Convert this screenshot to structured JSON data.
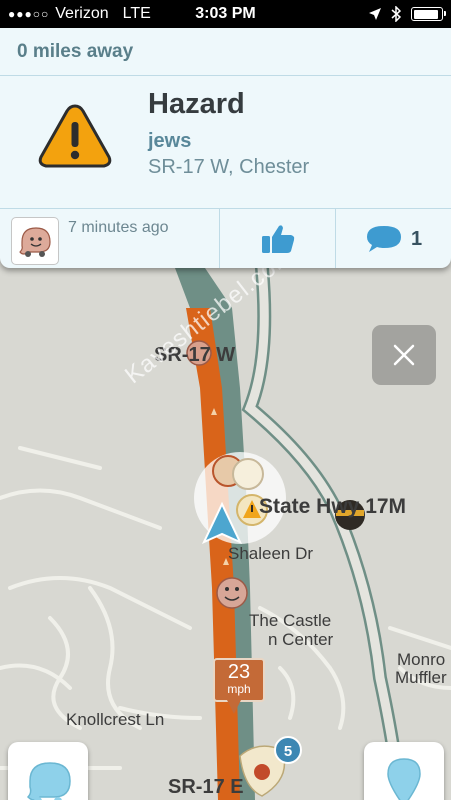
{
  "status_bar": {
    "signal": "●●●○○",
    "carrier": "Verizon",
    "network": "LTE",
    "time": "3:03 PM",
    "battery_level": 0.9
  },
  "alert_card": {
    "distance": "0 miles away",
    "title": "Hazard",
    "subtitle": "jews",
    "location": "SR-17 W, Chester",
    "reported_time": "7 minutes ago",
    "comment_count": "1",
    "icon": "warning-triangle-icon"
  },
  "map": {
    "labels": {
      "sr17w": "SR-17 W",
      "state_hwy": "State Hwy 17M",
      "shaleen": "Shaleen Dr",
      "castle_1": "The Castle",
      "castle_2": "n Center",
      "monroe_1": "Monro",
      "monroe_2": "Muffler",
      "knollcrest": "Knollcrest Ln",
      "sr17e": "SR-17 E"
    },
    "watermark": "Kaveshtiebel.com",
    "speed": "23",
    "speed_unit": "mph",
    "report_count": "5"
  },
  "colors": {
    "route": "#d9641a",
    "road_fill": "#e4e4de",
    "road_edge": "#6f8f86",
    "card_bg": "#eef8fb",
    "accent": "#3c87b3"
  }
}
